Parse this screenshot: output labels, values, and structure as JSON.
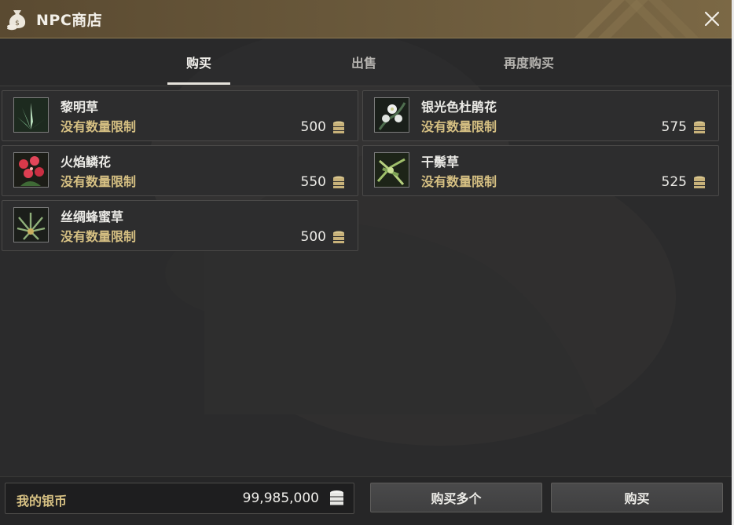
{
  "window": {
    "title": "NPC商店"
  },
  "tabs": [
    {
      "label": "购买",
      "active": true
    },
    {
      "label": "出售",
      "active": false
    },
    {
      "label": "再度购买",
      "active": false
    }
  ],
  "items": [
    {
      "name": "黎明草",
      "limit": "没有数量限制",
      "price": "500",
      "icon": "dawn-grass-icon"
    },
    {
      "name": "银光色杜鹃花",
      "limit": "没有数量限制",
      "price": "575",
      "icon": "silver-azalea-icon"
    },
    {
      "name": "火焰鳞花",
      "limit": "没有数量限制",
      "price": "550",
      "icon": "flame-scale-flower-icon"
    },
    {
      "name": "干鬃草",
      "limit": "没有数量限制",
      "price": "525",
      "icon": "dry-mane-grass-icon"
    },
    {
      "name": "丝绸蜂蜜草",
      "limit": "没有数量限制",
      "price": "500",
      "icon": "silk-honey-grass-icon"
    }
  ],
  "wallet": {
    "label": "我的银币",
    "amount": "99,985,000",
    "icon": "silver-coin-stack-icon"
  },
  "buttons": {
    "buy_multiple": "购买多个",
    "buy": "购买"
  },
  "colors": {
    "title_bar": "#6b5a3c",
    "accent_gold": "#d7c183",
    "panel": "#2b2b2c"
  }
}
